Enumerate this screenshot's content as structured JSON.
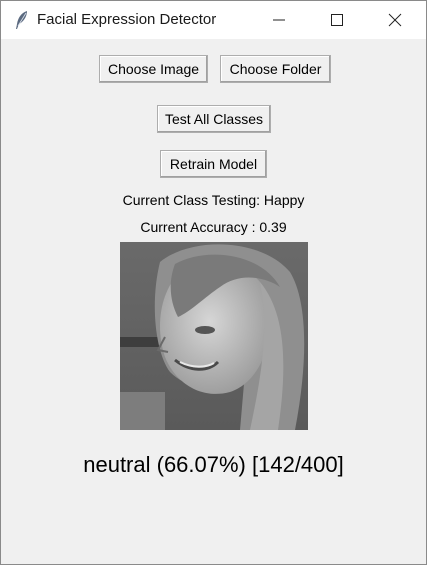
{
  "window": {
    "title": "Facial Expression Detector",
    "app_icon": "feather-icon",
    "controls": [
      "minimize-icon",
      "maximize-icon",
      "close-icon"
    ]
  },
  "toolbar": {
    "choose_image_label": "Choose Image",
    "choose_folder_label": "Choose Folder",
    "test_all_label": "Test All Classes",
    "retrain_label": "Retrain Model"
  },
  "status": {
    "current_class": "Current Class Testing: Happy",
    "current_accuracy": "Current Accuracy : 0.39"
  },
  "prediction": {
    "text": "neutral (66.07%) [142/400]"
  },
  "colors": {
    "window_bg": "#f0f0f0",
    "titlebar_bg": "#ffffff",
    "button_border": "#adadad"
  }
}
